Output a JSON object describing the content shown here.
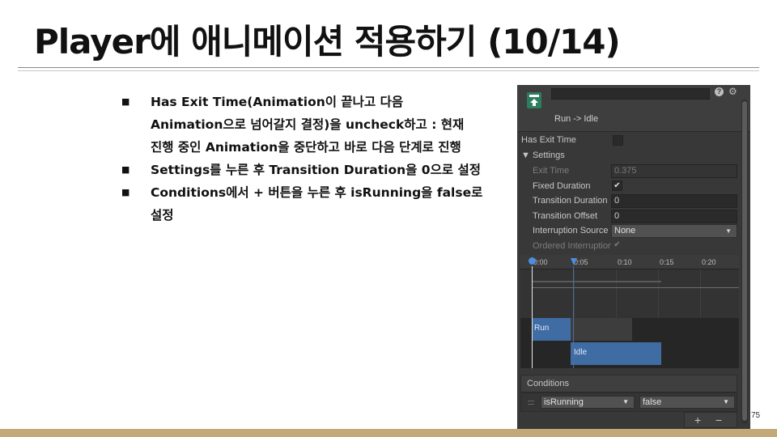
{
  "slide": {
    "title": "Player에 애니메이션 적용하기 (10/14)",
    "page_number": "75",
    "bullet_marker": "■",
    "bullets": [
      {
        "lines": [
          "Has Exit Time(Animation이 끝나고 다음",
          "Animation으로 넘어갈지 결정)을 uncheck하고 : 현재",
          "진행 중인 Animation을 중단하고 바로 다음 단계로 진행"
        ]
      },
      {
        "lines": [
          "Settings를 누른 후 Transition Duration을 0으로 설정"
        ]
      },
      {
        "lines": [
          "Conditions에서 + 버튼을 누른 후 isRunning을 false로",
          "설정"
        ]
      }
    ]
  },
  "inspector": {
    "transition_name": "Run -> Idle",
    "help_icon": "?",
    "gear_icon": "⚙",
    "has_exit_time_label": "Has Exit Time",
    "settings_label": "▼ Settings",
    "fields": [
      {
        "label": "Exit Time",
        "value": "0.375",
        "kind": "text",
        "dim": true
      },
      {
        "label": "Fixed Duration",
        "value": "✔",
        "kind": "check",
        "dim": false
      },
      {
        "label": "Transition Duration",
        "value": "0",
        "kind": "text",
        "dim": false
      },
      {
        "label": "Transition Offset",
        "value": "0",
        "kind": "text",
        "dim": false
      },
      {
        "label": "Interruption Source",
        "value": "None",
        "kind": "dropdown",
        "dim": false
      },
      {
        "label": "Ordered Interruption",
        "value": "✔",
        "kind": "check",
        "dim": true
      }
    ],
    "timeline": {
      "ticks": [
        "0:00",
        "0:05",
        "0:10",
        "0:15",
        "0:20"
      ],
      "clips": {
        "from": "Run",
        "to": "Idle"
      }
    },
    "conditions": {
      "header": "Conditions",
      "parameter": "isRunning",
      "value": "false",
      "dropdown_arrow": "▼",
      "add_label": "+",
      "remove_label": "−"
    }
  },
  "colors": {
    "bottom_bar": "#c3a878",
    "inspector_bg": "#383838",
    "clip_blue": "#3f6ca3",
    "playhead_blue": "#4c8fe0"
  }
}
